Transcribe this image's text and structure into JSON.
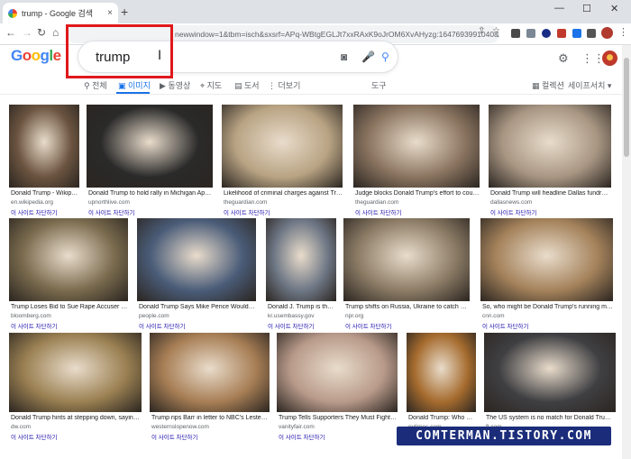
{
  "browser": {
    "tab_title": "trump - Google 검색",
    "tab_close": "×",
    "new_tab": "+",
    "url": "newwindow=1&tbm=isch&sxsrf=APq-WBtgEGLJt7xxRAxK9oJrOM6XvAHyzg:1647693991040&sour...",
    "win_min": "—",
    "win_max": "☐",
    "win_close": "✕"
  },
  "google": {
    "logo_letters": [
      "G",
      "o",
      "o",
      "g",
      "l",
      "e"
    ],
    "logo_colors": [
      "#4285f4",
      "#ea4335",
      "#fbbc05",
      "#4285f4",
      "#34a853",
      "#ea4335"
    ],
    "query": "trump"
  },
  "search_tabs": [
    {
      "label": "전체",
      "icon": "search-icon"
    },
    {
      "label": "이미지",
      "icon": "image-icon"
    },
    {
      "label": "동영상",
      "icon": "video-icon"
    },
    {
      "label": "지도",
      "icon": "map-pin-icon"
    },
    {
      "label": "도서",
      "icon": "book-icon"
    },
    {
      "label": "더보기",
      "icon": "more-icon"
    }
  ],
  "tools_label": "도구",
  "collections_label": "컬렉션",
  "safesearch_label": "세이프서치 ▾",
  "visit_label": "이 사이트 차단하기",
  "results": [
    {
      "title": "Donald Trump - Wikipe...",
      "source": "en.wikipedia.org",
      "color": "#6b5440"
    },
    {
      "title": "Donald Trump to hold rally in Michigan April 2...",
      "source": "upnorthlive.com",
      "color": "#2a2a2a"
    },
    {
      "title": "Likelihood of criminal charges against Trum...",
      "source": "theguardian.com",
      "color": "#b8a383"
    },
    {
      "title": "Judge blocks Donald Trump's effort to counte...",
      "source": "theguardian.com",
      "color": "#8a7460"
    },
    {
      "title": "Donald Trump will headline Dallas fundraiser ...",
      "source": "dallasnews.com",
      "color": "#a89683"
    },
    {
      "title": "Trump Loses Bid to Sue Rape Accuser in D...",
      "source": "bloomberg.com",
      "color": "#7a6b4e"
    },
    {
      "title": "Donald Trump Says Mike Pence Wouldn't B...",
      "source": "people.com",
      "color": "#4a5c78"
    },
    {
      "title": "Donald J. Trump is the ...",
      "source": "kr.usembassy.gov",
      "color": "#6d7684"
    },
    {
      "title": "Trump shifts on Russia, Ukraine to catch up to...",
      "source": "npr.org",
      "color": "#8c7c66"
    },
    {
      "title": "So, who might be Donald Trump's running mate?...",
      "source": "cnn.com",
      "color": "#a4825b"
    },
    {
      "title": "Donald Trump hints at stepping down, saying 'W...",
      "source": "dw.com",
      "color": "#9a8052"
    },
    {
      "title": "Trump rips Barr in letter to NBC's Lester H...",
      "source": "westernslopenow.com",
      "color": "#a77e55"
    },
    {
      "title": "Trump Tells Supporters They Must Fight to ...",
      "source": "vanityfair.com",
      "color": "#b89a8a"
    },
    {
      "title": "Donald Trump: Who He...",
      "source": "nytimes.com",
      "color": "#a56b2e"
    },
    {
      "title": "The US system is no match for Donald Trump | ...",
      "source": "ft.com",
      "color": "#3f3f42"
    }
  ],
  "watermark": "COMTERMAN.TISTORY.COM"
}
